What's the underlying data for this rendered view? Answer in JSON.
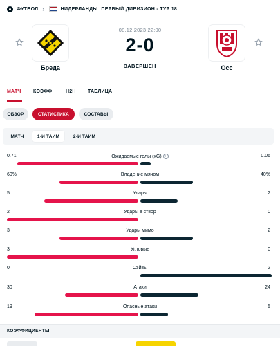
{
  "breadcrumb": {
    "sport": "ФУТБОЛ",
    "competition": "НИДЕРЛАНДЫ: ПЕРВЫЙ ДИВИЗИОН - ТУР 18"
  },
  "match": {
    "date": "08.12.2023 22:00",
    "score": "2-0",
    "status": "ЗАВЕРШЕН",
    "home_team": "Бреда",
    "away_team": "Осс"
  },
  "tabs": [
    "МАТЧ",
    "КОЭФФ",
    "H2H",
    "ТАБЛИЦА"
  ],
  "pills": [
    "ОБЗОР",
    "СТАТИСТИКА",
    "СОСТАВЫ"
  ],
  "period_tabs": [
    "МАТЧ",
    "1-Й ТАЙМ",
    "2-Й ТАЙМ"
  ],
  "stats": [
    {
      "name": "Ожидаемые голы (xG)",
      "home": "0.71",
      "away": "0.06",
      "home_value": 0.71,
      "away_value": 0.06
    },
    {
      "name": "Владение мячом",
      "home": "60%",
      "away": "40%",
      "home_value": 60,
      "away_value": 40
    },
    {
      "name": "Удары",
      "home": "5",
      "away": "2",
      "home_value": 5,
      "away_value": 2
    },
    {
      "name": "Удары в створ",
      "home": "2",
      "away": "0",
      "home_value": 2,
      "away_value": 0
    },
    {
      "name": "Удары мимо",
      "home": "3",
      "away": "2",
      "home_value": 3,
      "away_value": 2
    },
    {
      "name": "Угловые",
      "home": "3",
      "away": "0",
      "home_value": 3,
      "away_value": 0
    },
    {
      "name": "Сэйвы",
      "home": "0",
      "away": "2",
      "home_value": 0,
      "away_value": 2
    },
    {
      "name": "Атаки",
      "home": "30",
      "away": "24",
      "home_value": 30,
      "away_value": 24
    },
    {
      "name": "Опасные атаки",
      "home": "19",
      "away": "5",
      "home_value": 19,
      "away_value": 5
    }
  ],
  "odds": {
    "title": "КОЭФФИЦИЕНТЫ"
  },
  "icons": {
    "sport": "football-icon",
    "country": "netherlands-flag-icon",
    "favorite": "star-outline-icon",
    "info": "info-icon"
  },
  "colors": {
    "accent": "#c8102e",
    "home_bar": "#e5144b",
    "away_bar": "#0c2632",
    "text": "#00141e"
  }
}
